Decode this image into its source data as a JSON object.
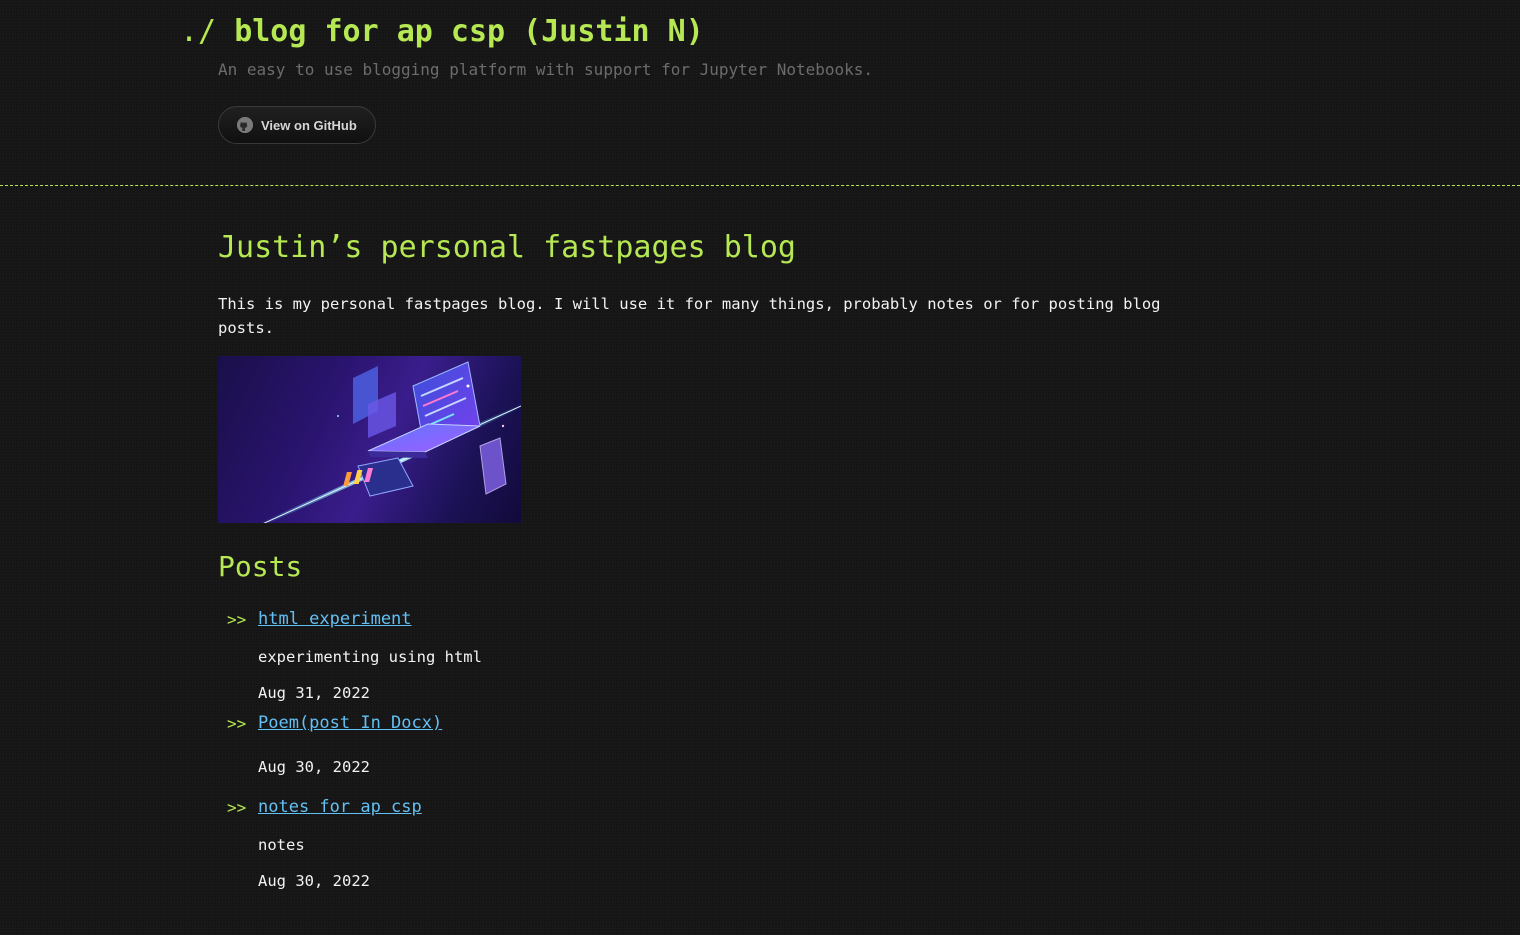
{
  "header": {
    "prompt": "./",
    "title": "blog for ap csp (Justin N)",
    "tagline": "An easy to use blogging platform with support for Jupyter Notebooks.",
    "github_button_label": "View on GitHub"
  },
  "main": {
    "heading": "Justin’s personal fastpages blog",
    "intro": "This is my personal fastpages blog. I will use it for many things, probably notes or for posting blog posts.",
    "hero_image_icon": "laptop-isometric-illustration",
    "posts_heading": "Posts",
    "bullet": ">>",
    "posts": [
      {
        "title": "html experiment",
        "description": "experimenting using html",
        "date": "Aug 31, 2022"
      },
      {
        "title": "Poem(post In Docx)",
        "description": "",
        "date": "Aug 30, 2022"
      },
      {
        "title": "notes for ap csp",
        "description": "notes",
        "date": "Aug 30, 2022"
      }
    ]
  },
  "colors": {
    "background": "#151515",
    "accent_green": "#b5e853",
    "link_blue": "#63c0f5",
    "muted_text": "#6c6c6c",
    "body_text": "#f2f2f2"
  }
}
